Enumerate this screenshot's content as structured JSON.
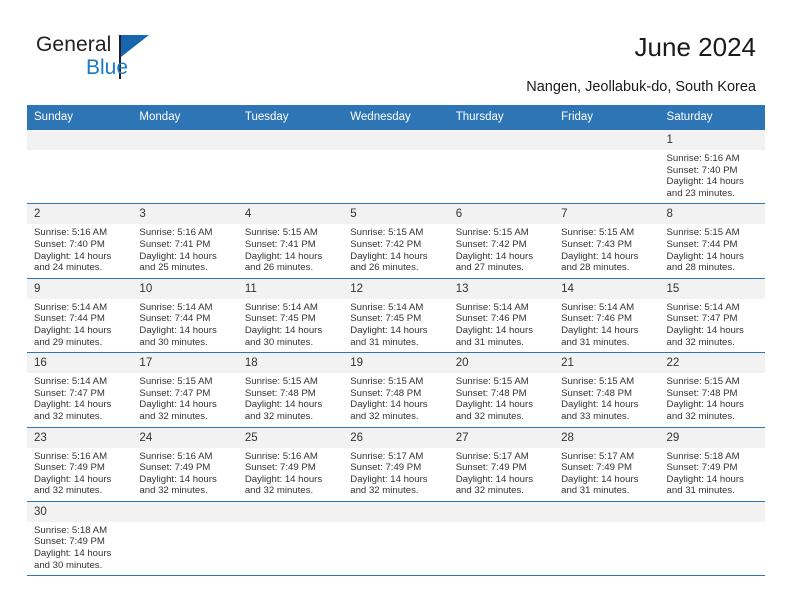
{
  "brand": {
    "name_part1": "General",
    "name_part2": "Blue"
  },
  "header": {
    "title": "June 2024",
    "subtitle": "Nangen, Jeollabuk-do, South Korea"
  },
  "colors": {
    "header_blue": "#2e75b6",
    "daynum_gray": "#f2f2f2",
    "brand_blue": "#1b7ac4",
    "text": "#333333"
  },
  "calendar": {
    "weekday_headers": [
      "Sunday",
      "Monday",
      "Tuesday",
      "Wednesday",
      "Thursday",
      "Friday",
      "Saturday"
    ],
    "weeks": [
      [
        {
          "day": "",
          "blank": true
        },
        {
          "day": "",
          "blank": true
        },
        {
          "day": "",
          "blank": true
        },
        {
          "day": "",
          "blank": true
        },
        {
          "day": "",
          "blank": true
        },
        {
          "day": "",
          "blank": true
        },
        {
          "day": "1",
          "sunrise": "Sunrise: 5:16 AM",
          "sunset": "Sunset: 7:40 PM",
          "daylight1": "Daylight: 14 hours",
          "daylight2": "and 23 minutes."
        }
      ],
      [
        {
          "day": "2",
          "sunrise": "Sunrise: 5:16 AM",
          "sunset": "Sunset: 7:40 PM",
          "daylight1": "Daylight: 14 hours",
          "daylight2": "and 24 minutes."
        },
        {
          "day": "3",
          "sunrise": "Sunrise: 5:16 AM",
          "sunset": "Sunset: 7:41 PM",
          "daylight1": "Daylight: 14 hours",
          "daylight2": "and 25 minutes."
        },
        {
          "day": "4",
          "sunrise": "Sunrise: 5:15 AM",
          "sunset": "Sunset: 7:41 PM",
          "daylight1": "Daylight: 14 hours",
          "daylight2": "and 26 minutes."
        },
        {
          "day": "5",
          "sunrise": "Sunrise: 5:15 AM",
          "sunset": "Sunset: 7:42 PM",
          "daylight1": "Daylight: 14 hours",
          "daylight2": "and 26 minutes."
        },
        {
          "day": "6",
          "sunrise": "Sunrise: 5:15 AM",
          "sunset": "Sunset: 7:42 PM",
          "daylight1": "Daylight: 14 hours",
          "daylight2": "and 27 minutes."
        },
        {
          "day": "7",
          "sunrise": "Sunrise: 5:15 AM",
          "sunset": "Sunset: 7:43 PM",
          "daylight1": "Daylight: 14 hours",
          "daylight2": "and 28 minutes."
        },
        {
          "day": "8",
          "sunrise": "Sunrise: 5:15 AM",
          "sunset": "Sunset: 7:44 PM",
          "daylight1": "Daylight: 14 hours",
          "daylight2": "and 28 minutes."
        }
      ],
      [
        {
          "day": "9",
          "sunrise": "Sunrise: 5:14 AM",
          "sunset": "Sunset: 7:44 PM",
          "daylight1": "Daylight: 14 hours",
          "daylight2": "and 29 minutes."
        },
        {
          "day": "10",
          "sunrise": "Sunrise: 5:14 AM",
          "sunset": "Sunset: 7:44 PM",
          "daylight1": "Daylight: 14 hours",
          "daylight2": "and 30 minutes."
        },
        {
          "day": "11",
          "sunrise": "Sunrise: 5:14 AM",
          "sunset": "Sunset: 7:45 PM",
          "daylight1": "Daylight: 14 hours",
          "daylight2": "and 30 minutes."
        },
        {
          "day": "12",
          "sunrise": "Sunrise: 5:14 AM",
          "sunset": "Sunset: 7:45 PM",
          "daylight1": "Daylight: 14 hours",
          "daylight2": "and 31 minutes."
        },
        {
          "day": "13",
          "sunrise": "Sunrise: 5:14 AM",
          "sunset": "Sunset: 7:46 PM",
          "daylight1": "Daylight: 14 hours",
          "daylight2": "and 31 minutes."
        },
        {
          "day": "14",
          "sunrise": "Sunrise: 5:14 AM",
          "sunset": "Sunset: 7:46 PM",
          "daylight1": "Daylight: 14 hours",
          "daylight2": "and 31 minutes."
        },
        {
          "day": "15",
          "sunrise": "Sunrise: 5:14 AM",
          "sunset": "Sunset: 7:47 PM",
          "daylight1": "Daylight: 14 hours",
          "daylight2": "and 32 minutes."
        }
      ],
      [
        {
          "day": "16",
          "sunrise": "Sunrise: 5:14 AM",
          "sunset": "Sunset: 7:47 PM",
          "daylight1": "Daylight: 14 hours",
          "daylight2": "and 32 minutes."
        },
        {
          "day": "17",
          "sunrise": "Sunrise: 5:15 AM",
          "sunset": "Sunset: 7:47 PM",
          "daylight1": "Daylight: 14 hours",
          "daylight2": "and 32 minutes."
        },
        {
          "day": "18",
          "sunrise": "Sunrise: 5:15 AM",
          "sunset": "Sunset: 7:48 PM",
          "daylight1": "Daylight: 14 hours",
          "daylight2": "and 32 minutes."
        },
        {
          "day": "19",
          "sunrise": "Sunrise: 5:15 AM",
          "sunset": "Sunset: 7:48 PM",
          "daylight1": "Daylight: 14 hours",
          "daylight2": "and 32 minutes."
        },
        {
          "day": "20",
          "sunrise": "Sunrise: 5:15 AM",
          "sunset": "Sunset: 7:48 PM",
          "daylight1": "Daylight: 14 hours",
          "daylight2": "and 32 minutes."
        },
        {
          "day": "21",
          "sunrise": "Sunrise: 5:15 AM",
          "sunset": "Sunset: 7:48 PM",
          "daylight1": "Daylight: 14 hours",
          "daylight2": "and 33 minutes."
        },
        {
          "day": "22",
          "sunrise": "Sunrise: 5:15 AM",
          "sunset": "Sunset: 7:48 PM",
          "daylight1": "Daylight: 14 hours",
          "daylight2": "and 32 minutes."
        }
      ],
      [
        {
          "day": "23",
          "sunrise": "Sunrise: 5:16 AM",
          "sunset": "Sunset: 7:49 PM",
          "daylight1": "Daylight: 14 hours",
          "daylight2": "and 32 minutes."
        },
        {
          "day": "24",
          "sunrise": "Sunrise: 5:16 AM",
          "sunset": "Sunset: 7:49 PM",
          "daylight1": "Daylight: 14 hours",
          "daylight2": "and 32 minutes."
        },
        {
          "day": "25",
          "sunrise": "Sunrise: 5:16 AM",
          "sunset": "Sunset: 7:49 PM",
          "daylight1": "Daylight: 14 hours",
          "daylight2": "and 32 minutes."
        },
        {
          "day": "26",
          "sunrise": "Sunrise: 5:17 AM",
          "sunset": "Sunset: 7:49 PM",
          "daylight1": "Daylight: 14 hours",
          "daylight2": "and 32 minutes."
        },
        {
          "day": "27",
          "sunrise": "Sunrise: 5:17 AM",
          "sunset": "Sunset: 7:49 PM",
          "daylight1": "Daylight: 14 hours",
          "daylight2": "and 32 minutes."
        },
        {
          "day": "28",
          "sunrise": "Sunrise: 5:17 AM",
          "sunset": "Sunset: 7:49 PM",
          "daylight1": "Daylight: 14 hours",
          "daylight2": "and 31 minutes."
        },
        {
          "day": "29",
          "sunrise": "Sunrise: 5:18 AM",
          "sunset": "Sunset: 7:49 PM",
          "daylight1": "Daylight: 14 hours",
          "daylight2": "and 31 minutes."
        }
      ],
      [
        {
          "day": "30",
          "sunrise": "Sunrise: 5:18 AM",
          "sunset": "Sunset: 7:49 PM",
          "daylight1": "Daylight: 14 hours",
          "daylight2": "and 30 minutes."
        },
        {
          "day": "",
          "blank": true
        },
        {
          "day": "",
          "blank": true
        },
        {
          "day": "",
          "blank": true
        },
        {
          "day": "",
          "blank": true
        },
        {
          "day": "",
          "blank": true
        },
        {
          "day": "",
          "blank": true
        }
      ]
    ]
  }
}
